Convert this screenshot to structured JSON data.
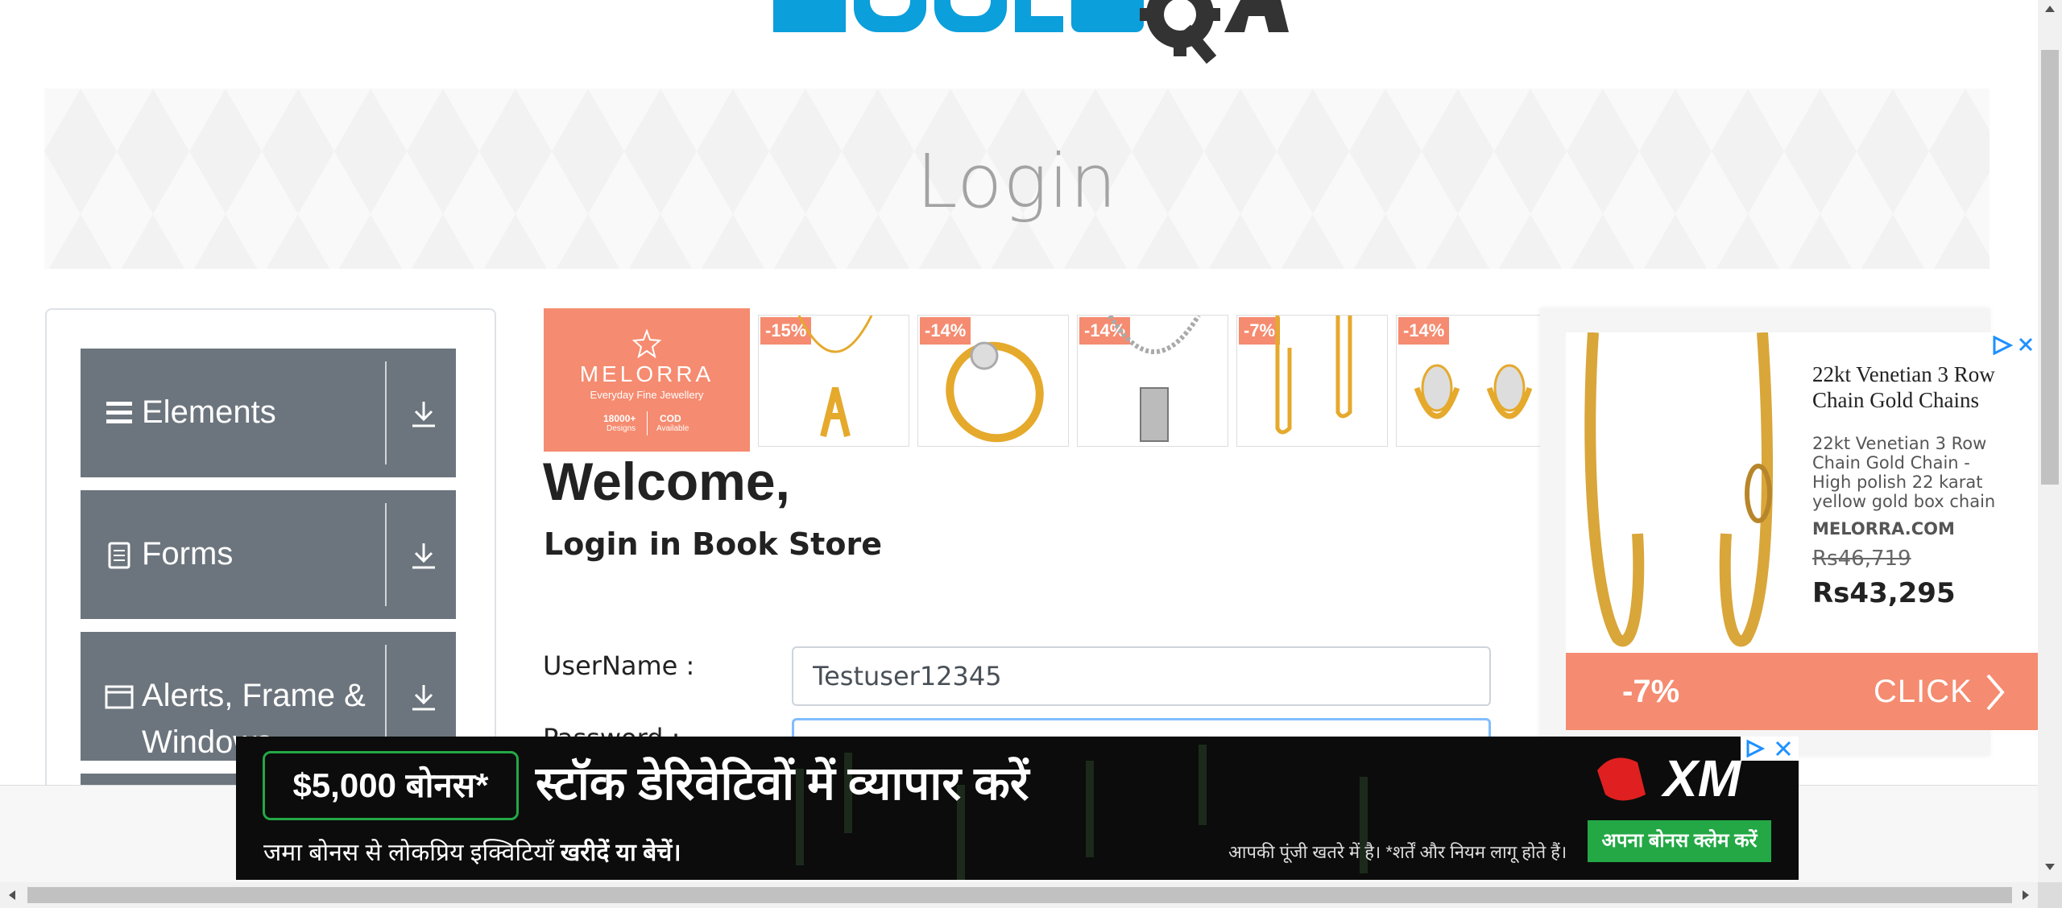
{
  "logo": {
    "alt": "ToolsQA logo"
  },
  "banner": {
    "title": "Login"
  },
  "sidebar": {
    "groups": [
      {
        "label": "Elements",
        "icon": "hamburger-icon"
      },
      {
        "label": "Forms",
        "icon": "document-icon"
      },
      {
        "label": "Alerts, Frame & Windows",
        "icon": "window-icon"
      }
    ]
  },
  "product_ad": {
    "brand": "MELORRA",
    "tagline": "Everyday Fine Jewellery",
    "stat1": "18000+",
    "stat1_sub": "Designs",
    "stat2": "COD",
    "stat2_sub": "Available",
    "discounts": [
      "-15%",
      "-14%",
      "-14%",
      "-7%",
      "-14%"
    ]
  },
  "main": {
    "welcome": "Welcome,",
    "subtitle": "Login in Book Store",
    "username_label": "UserName :",
    "username_value": "Testuser12345",
    "password_label": "Password :"
  },
  "right_ad": {
    "title": "22kt Venetian 3 Row Chain Gold Chains",
    "description": "22kt Venetian 3 Row Chain Gold Chain - High polish 22 karat yellow gold box chain that has...",
    "site": "MELORRA.COM",
    "old_price": "Rs46,719",
    "price": "Rs43,295",
    "discount": "-7%",
    "cta": "CLICK"
  },
  "bottom_ad": {
    "bonus": "$5,000 बोनस*",
    "headline": "स्टॉक डेरिवेटिवों में व्यापार करें",
    "sub_plain": "जमा बोनस से लोकप्रिय इक्विटियाँ ",
    "sub_bold": "खरीदें या बेचें।",
    "risk": "आपकी पूंजी खतरे में है। *शर्तें और नियम लागू होते हैं।",
    "cta": "अपना बोनस क्लेम करें",
    "brand": "XM"
  },
  "colors": {
    "sidebar_group": "#6c757d",
    "accent_salmon": "#f58b70",
    "xm_green": "#23a845",
    "logo_blue": "#0b9fdb"
  }
}
